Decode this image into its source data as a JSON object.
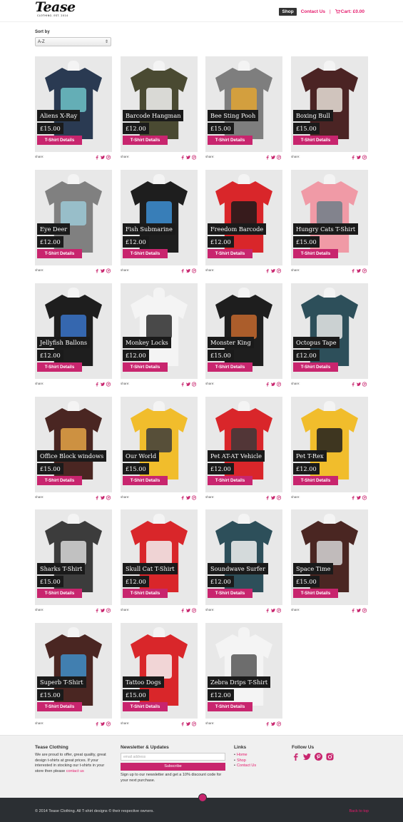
{
  "brand": {
    "name": "Tease",
    "tagline": "CLOTHING. EST. 2014"
  },
  "nav": {
    "items": [
      "Shop",
      "Contact Us"
    ],
    "separator": "|",
    "cart": "Cart: £0.00"
  },
  "sort": {
    "label": "Sort by",
    "selected": "A-Z"
  },
  "product_common": {
    "details_label": "T-Shirt Details",
    "share_label": "share:"
  },
  "products": [
    {
      "name": "Aliens X-Ray",
      "price": "£15.00",
      "shirt_color": "#2a3a52",
      "print_color": "#6fc3c8"
    },
    {
      "name": "Barcode Hangman",
      "price": "£12.00",
      "shirt_color": "#4a4a32",
      "print_color": "#f2f2f2"
    },
    {
      "name": "Bee Sting Pooh",
      "price": "£15.00",
      "shirt_color": "#7e7e7e",
      "print_color": "#e2a532"
    },
    {
      "name": "Boxing Bull",
      "price": "£15.00",
      "shirt_color": "#4b2424",
      "print_color": "#e8e0d8"
    },
    {
      "name": "Eye Deer",
      "price": "£12.00",
      "shirt_color": "#808080",
      "print_color": "#9cc9d6"
    },
    {
      "name": "Fish Submarine",
      "price": "£12.00",
      "shirt_color": "#1e1e1e",
      "print_color": "#3d8fd4"
    },
    {
      "name": "Freedom Barcode",
      "price": "£12.00",
      "shirt_color": "#d9262a",
      "print_color": "#1a1a1a"
    },
    {
      "name": "Hungry Cats T-Shirt",
      "price": "£15.00",
      "shirt_color": "#f09aa6",
      "print_color": "#6f7f88"
    },
    {
      "name": "Jellyfish Ballons",
      "price": "£12.00",
      "shirt_color": "#1e1e1e",
      "print_color": "#3a74c9"
    },
    {
      "name": "Monkey Locks",
      "price": "£12.00",
      "shirt_color": "#f4f4f4",
      "print_color": "#2a2a2a"
    },
    {
      "name": "Monster King",
      "price": "£15.00",
      "shirt_color": "#1e1e1e",
      "print_color": "#c4682e"
    },
    {
      "name": "Octopus Tape",
      "price": "£12.00",
      "shirt_color": "#2d4f5a",
      "print_color": "#e8e8e8"
    },
    {
      "name": "Office Block windows",
      "price": "£15.00",
      "shirt_color": "#4a2622",
      "print_color": "#e4a447"
    },
    {
      "name": "Our World",
      "price": "£15.00",
      "shirt_color": "#f1bd2c",
      "print_color": "#3c3c3c"
    },
    {
      "name": "Pet AT-AT Vehicle",
      "price": "£12.00",
      "shirt_color": "#d9262a",
      "print_color": "#3a3a3a"
    },
    {
      "name": "Pet T-Rex",
      "price": "£12.00",
      "shirt_color": "#f1bd2c",
      "print_color": "#1e1e1e"
    },
    {
      "name": "Sharks T-Shirt",
      "price": "£15.00",
      "shirt_color": "#3c3c3c",
      "print_color": "#d8d8d8"
    },
    {
      "name": "Skull Cat T-Shirt",
      "price": "£12.00",
      "shirt_color": "#d9262a",
      "print_color": "#f2f2f2"
    },
    {
      "name": "Soundwave Surfer",
      "price": "£12.00",
      "shirt_color": "#2d4f5a",
      "print_color": "#f2f2f2"
    },
    {
      "name": "Space Time",
      "price": "£15.00",
      "shirt_color": "#4a2622",
      "print_color": "#d6d6d6"
    },
    {
      "name": "Superb T-Shirt",
      "price": "£15.00",
      "shirt_color": "#4a2622",
      "print_color": "#3f8fc9"
    },
    {
      "name": "Tattoo Dogs",
      "price": "£15.00",
      "shirt_color": "#d9262a",
      "print_color": "#f4f4f4"
    },
    {
      "name": "Zebra Drips T-Shirt",
      "price": "£12.00",
      "shirt_color": "#f4f4f4",
      "print_color": "#555555"
    }
  ],
  "footer": {
    "about": {
      "title": "Tease Clothing",
      "text": "We are proud to offer, great quality, great design t-shirts at great prices. If your interested in stocking our t-shirts in your store then please",
      "link": "contact us"
    },
    "newsletter": {
      "title": "Newsletter & Updates",
      "placeholder": "email address",
      "button": "Subscribe",
      "note": "Sign up to our newsletter and get a 10% discount code for your next purchase."
    },
    "links": {
      "title": "Links",
      "items": [
        "Home",
        "Shop",
        "Contact Us"
      ]
    },
    "follow": {
      "title": "Follow Us",
      "icons": [
        "facebook-icon",
        "twitter-icon",
        "pinterest-icon",
        "instagram-icon"
      ]
    }
  },
  "bottom": {
    "copyright": "© 2014 Tease Clothing. All T-shirt designs © their respective owners.",
    "back_to_top": "Back to top"
  },
  "colors": {
    "accent": "#c8256e",
    "link": "#e51a6c",
    "dark": "#1a1a1a",
    "bottom_bar": "#2b2f33"
  }
}
